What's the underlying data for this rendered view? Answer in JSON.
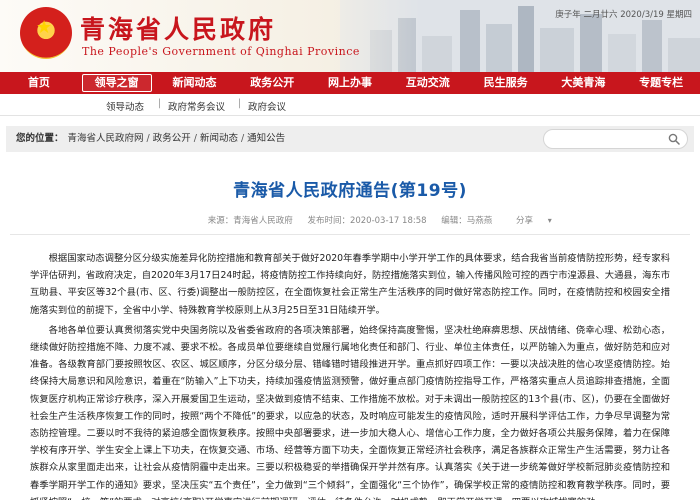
{
  "header": {
    "title": "青海省人民政府",
    "subtitle": "The People's Government of Qinghai Province",
    "date": "庚子年 二月廿六 2020/3/19 星期四"
  },
  "nav": {
    "items": [
      {
        "label": "首页"
      },
      {
        "label": "领导之窗"
      },
      {
        "label": "新闻动态"
      },
      {
        "label": "政务公开"
      },
      {
        "label": "网上办事"
      },
      {
        "label": "互动交流"
      },
      {
        "label": "民生服务"
      },
      {
        "label": "大美青海"
      },
      {
        "label": "专题专栏"
      }
    ],
    "active_index": 1
  },
  "subnav": {
    "items": [
      {
        "label": "领导动态"
      },
      {
        "label": "政府常务会议"
      },
      {
        "label": "政府会议"
      }
    ]
  },
  "breadcrumb": {
    "label": "您的位置：",
    "items": [
      "青海省人民政府网",
      "政务公开",
      "新闻动态",
      "通知公告"
    ],
    "separator": "/"
  },
  "search": {
    "placeholder": "",
    "icon": "search-icon"
  },
  "article": {
    "title": "青海省人民政府通告(第19号)",
    "source": "来源：青海省人民政府",
    "time": "发布时间：2020-03-17 18:58",
    "editor": "编辑：马燕燕",
    "share": "分享",
    "paragraphs": [
      "根据国家动态调整分区分级实施差异化防控措施和教育部关于做好2020年春季学期中小学开学工作的具体要求，结合我省当前疫情防控形势，经专家科学评估研判，省政府决定，自2020年3月17日24时起，将疫情防控工作持续向好，防控措施落实到位，输入传播风险可控的西宁市湟源县、大通县，海东市互助县、平安区等32个县(市、区、行委)调整出一般防控区，在全面恢复社会正常生产生活秩序的同时做好常态防控工作。同时，在疫情防控和校园安全措施落实到位的前提下，全省中小学、特殊教育学校原则上从3月25日至31日陆续开学。",
      "各地各单位要认真贯彻落实党中央国务院以及省委省政府的各项决策部署，始终保持高度警惕，坚决杜绝麻痹思想、厌战情绪、侥幸心理、松劲心态，继续做好防控措施不降、力度不减、要求不松。各成员单位要继续自觉履行属地化责任和部门、行业、单位主体责任，以严防输入为重点，做好防范和应对准备。各级教育部门要按照牧区、农区、城区顺序，分区分级分层、错峰错时错段推进开学。重点抓好四项工作：一要以决战决胜的信心攻坚疫情防控。始终保持大局意识和风险意识，着重在“防输入”上下功夫，持续加强疫情监测预警，做好重点部门疫情防控指导工作，严格落实重点人员追踪排查措施，全面恢复医疗机构正常诊疗秩序，深入开展爱国卫生运动，坚决做到疫情不结束、工作措施不放松。对于未调出一般防控区的13个县(市、区)，仍要在全面做好社会生产生活秩序恢复工作的同时，按照“两个不降低”的要求，以应急的状态，及时响应可能发生的疫情风险，适时开展科学评估工作，力争尽早调整为常态防控管理。二要以时不我待的紧迫感全面恢复秩序。按照中央部署要求，进一步加大稳人心、增信心工作力度，全力做好各项公共服务保障，着力在保障学校有序开学、学生安全上课上下功夫，在恢复交通、市场、经营等方面下功夫，全面恢复正常经济社会秩序，满足各族群众正常生产生活需要，努力让各族群众从家里面走出来，让社会从疫情阴霾中走出来。三要以积极稳妥的举措确保开学并然有序。认真落实《关于进一步统筹做好学校新冠肺炎疫情防控和春季学期开学工作的通知》要求，坚决压实“五个责任”，全力做到“三个倾斜”，全面强化“三个协作”，确保学校正常的疫情防控和教育教学秩序。同时，要抓紧按照“一校一策”的要求，对高校(高职)开学事宜进行前期调研、评估，待条件允许，时机成熟，即正常开学开课。四要以攻城拔寨的劲"
    ]
  },
  "colors": {
    "brand_red": "#c8161d",
    "title_blue": "#1a5aa8"
  }
}
